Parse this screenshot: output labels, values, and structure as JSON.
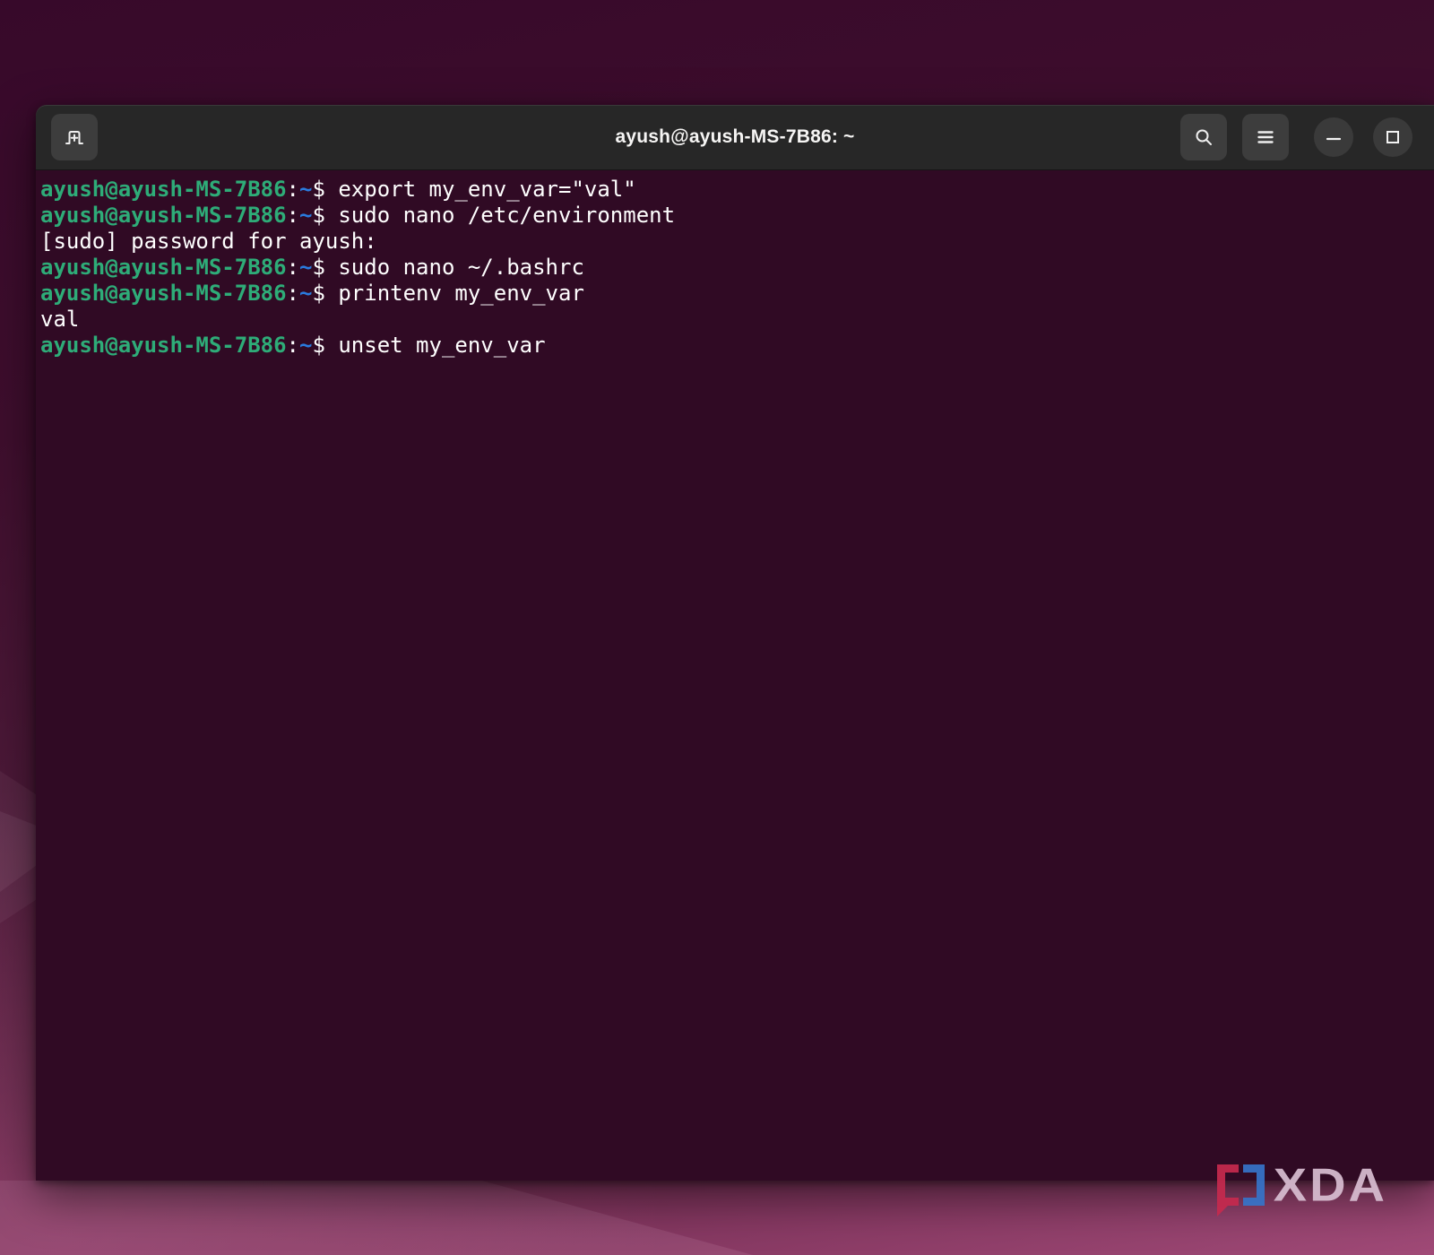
{
  "window": {
    "title": "ayush@ayush-MS-7B86: ~"
  },
  "header": {
    "icons": {
      "new_tab": "tab-with-plus",
      "search": "magnifier",
      "menu": "hamburger-three-lines",
      "minimize": "dash",
      "maximize": "square-outline"
    }
  },
  "terminal": {
    "prompt": "ayush@ayush-MS-7B86:~$",
    "lines": [
      {
        "segments": [
          {
            "t": "ayush@ayush-MS-7B86",
            "c": "user"
          },
          {
            "t": ":",
            "c": "plain"
          },
          {
            "t": "~",
            "c": "path"
          },
          {
            "t": "$ ",
            "c": "plain"
          },
          {
            "t": "export my_env_var=\"val\"",
            "c": "plain"
          }
        ]
      },
      {
        "segments": [
          {
            "t": "ayush@ayush-MS-7B86",
            "c": "user"
          },
          {
            "t": ":",
            "c": "plain"
          },
          {
            "t": "~",
            "c": "path"
          },
          {
            "t": "$ ",
            "c": "plain"
          },
          {
            "t": "sudo nano /etc/environment",
            "c": "plain"
          }
        ]
      },
      {
        "segments": [
          {
            "t": "[sudo] password for ayush:",
            "c": "plain"
          }
        ]
      },
      {
        "segments": [
          {
            "t": "ayush@ayush-MS-7B86",
            "c": "user"
          },
          {
            "t": ":",
            "c": "plain"
          },
          {
            "t": "~",
            "c": "path"
          },
          {
            "t": "$ ",
            "c": "plain"
          },
          {
            "t": "sudo nano ~/.bashrc",
            "c": "plain"
          }
        ]
      },
      {
        "segments": [
          {
            "t": "ayush@ayush-MS-7B86",
            "c": "user"
          },
          {
            "t": ":",
            "c": "plain"
          },
          {
            "t": "~",
            "c": "path"
          },
          {
            "t": "$ ",
            "c": "plain"
          },
          {
            "t": "printenv my_env_var",
            "c": "plain"
          }
        ]
      },
      {
        "segments": [
          {
            "t": "val",
            "c": "plain"
          }
        ]
      },
      {
        "segments": [
          {
            "t": "ayush@ayush-MS-7B86",
            "c": "user"
          },
          {
            "t": ":",
            "c": "plain"
          },
          {
            "t": "~",
            "c": "path"
          },
          {
            "t": "$ ",
            "c": "plain"
          },
          {
            "t": "unset my_env_var",
            "c": "plain"
          }
        ]
      }
    ]
  },
  "watermark": {
    "text": "XDA"
  },
  "colors": {
    "terminal_bg": "#300a24",
    "headerbar_bg": "#272727",
    "button_bg": "#3d3d3d",
    "prompt_green": "#2eac78",
    "path_blue": "#2a7bde",
    "text_white": "#ffffff",
    "desktop_top": "#37092a",
    "desktop_bottom": "#a04a77",
    "xda_red": "#c62a4e",
    "xda_blue": "#3674c9",
    "xda_letters": "#d9bfd2"
  }
}
